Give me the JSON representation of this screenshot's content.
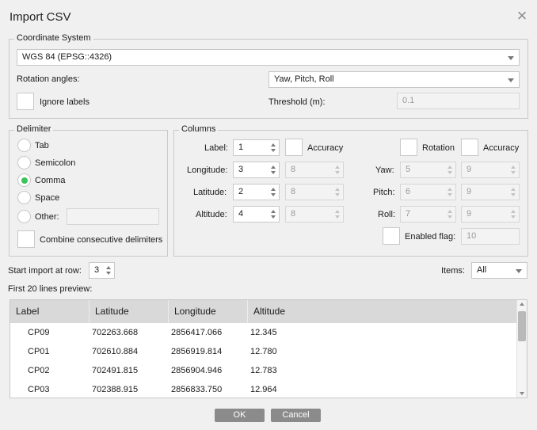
{
  "dialog": {
    "title": "Import CSV",
    "close_icon": "close-icon"
  },
  "coordinate_system": {
    "legend": "Coordinate System",
    "value": "WGS 84 (EPSG::4326)",
    "rotation_label": "Rotation angles:",
    "rotation_value": "Yaw, Pitch, Roll",
    "ignore_labels": "Ignore labels",
    "threshold_label": "Threshold (m):",
    "threshold_value": "0.1"
  },
  "delimiter": {
    "legend": "Delimiter",
    "options": [
      "Tab",
      "Semicolon",
      "Comma",
      "Space",
      "Other:"
    ],
    "selected": "Comma",
    "other_value": "",
    "combine_label": "Combine consecutive delimiters"
  },
  "columns": {
    "legend": "Columns",
    "accuracy_label": "Accuracy",
    "rotation_label": "Rotation",
    "rotation_accuracy_label": "Accuracy",
    "label": {
      "name": "Label:",
      "value": "1"
    },
    "longitude": {
      "name": "Longitude:",
      "value": "3",
      "accuracy": "8"
    },
    "latitude": {
      "name": "Latitude:",
      "value": "2",
      "accuracy": "8"
    },
    "altitude": {
      "name": "Altitude:",
      "value": "4",
      "accuracy": "8"
    },
    "yaw": {
      "name": "Yaw:",
      "value": "5",
      "accuracy": "9"
    },
    "pitch": {
      "name": "Pitch:",
      "value": "6",
      "accuracy": "9"
    },
    "roll": {
      "name": "Roll:",
      "value": "7",
      "accuracy": "9"
    },
    "enabled_flag": {
      "name": "Enabled flag:",
      "value": "10"
    }
  },
  "start_row": {
    "label": "Start import at row:",
    "value": "3"
  },
  "items": {
    "label": "Items:",
    "value": "All"
  },
  "preview": {
    "label": "First 20 lines preview:",
    "headers": [
      "Label",
      "Latitude",
      "Longitude",
      "Altitude"
    ],
    "rows": [
      [
        "CP09",
        "702263.668",
        "2856417.066",
        "12.345"
      ],
      [
        "CP01",
        "702610.884",
        "2856919.814",
        "12.780"
      ],
      [
        "CP02",
        "702491.815",
        "2856904.946",
        "12.783"
      ],
      [
        "CP03",
        "702388.915",
        "2856833.750",
        "12.964"
      ]
    ]
  },
  "buttons": {
    "ok": "OK",
    "cancel": "Cancel"
  }
}
